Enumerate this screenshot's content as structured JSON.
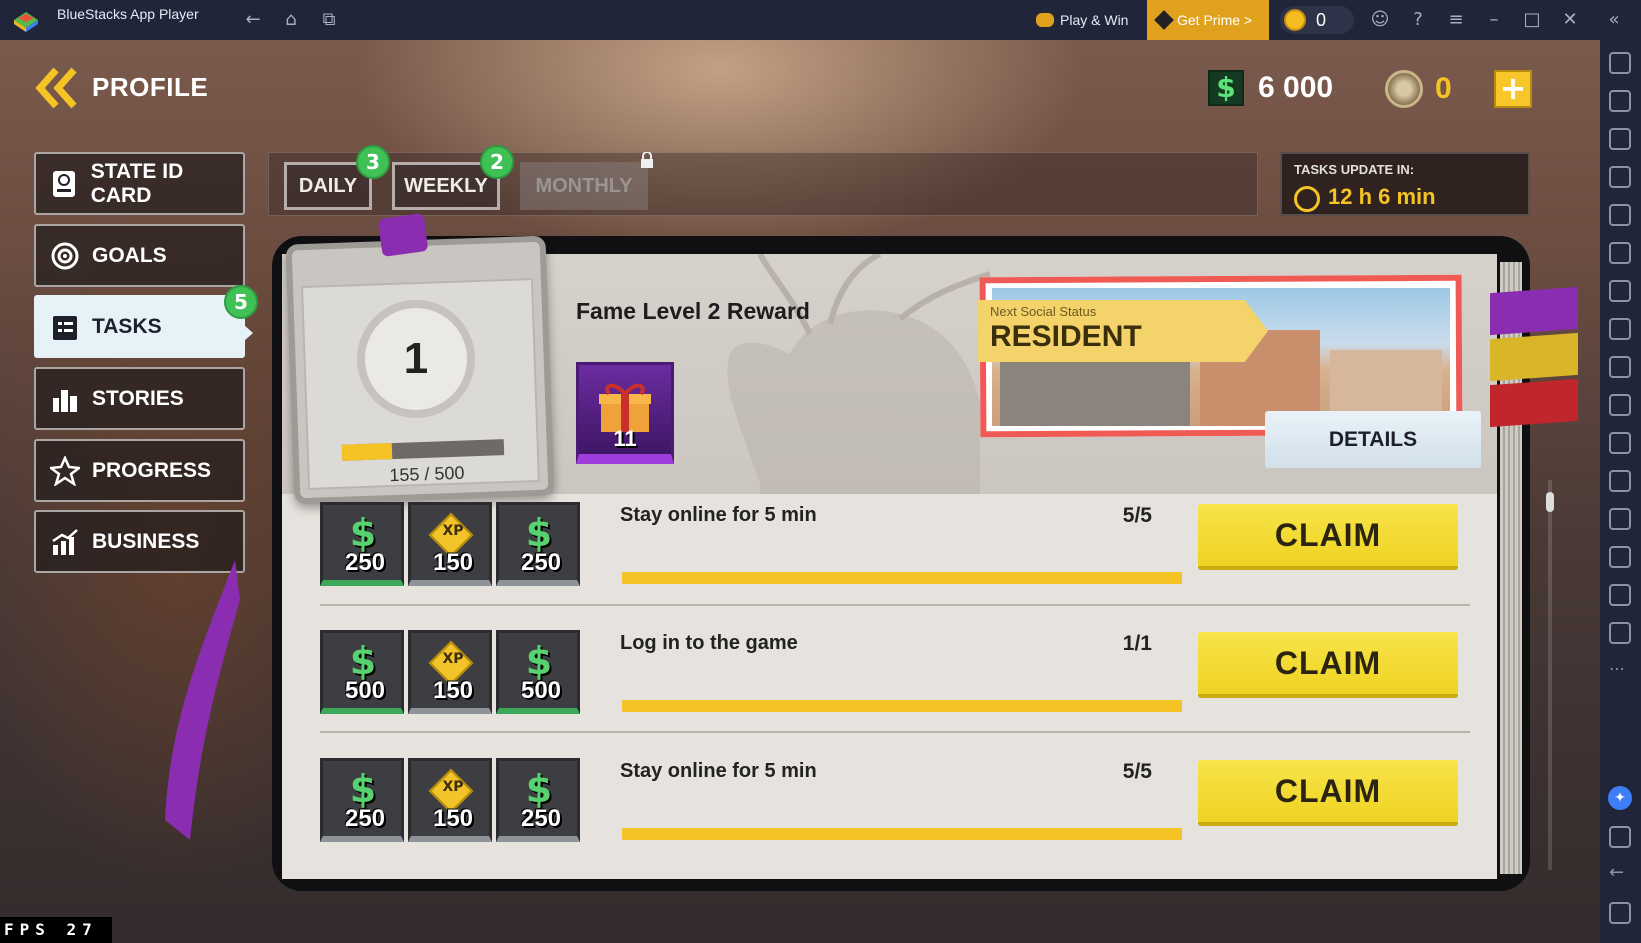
{
  "window": {
    "title": "BlueStacks App Player",
    "play_win": "Play & Win",
    "get_prime": "Get Prime >",
    "coins": "0"
  },
  "header": {
    "title": "PROFILE",
    "money": "6 000",
    "gold": "0"
  },
  "menu": {
    "items": [
      {
        "label": "STATE ID CARD",
        "icon": "id-card-icon"
      },
      {
        "label": "GOALS",
        "icon": "target-icon"
      },
      {
        "label": "TASKS",
        "icon": "checklist-icon",
        "active": true,
        "badge": "5"
      },
      {
        "label": "STORIES",
        "icon": "city-icon"
      },
      {
        "label": "PROGRESS",
        "icon": "star-icon"
      },
      {
        "label": "BUSINESS",
        "icon": "chart-icon"
      }
    ]
  },
  "tabs": [
    {
      "label": "DAILY",
      "badge": "3"
    },
    {
      "label": "WEEKLY",
      "badge": "2"
    },
    {
      "label": "MONTHLY",
      "locked": true
    }
  ],
  "timer": {
    "label": "TASKS UPDATE IN:",
    "value": "12 h 6 min"
  },
  "fame": {
    "level": "1",
    "progress_text": "155 / 500",
    "progress_fraction": 0.31,
    "reward_title": "Fame Level 2 Reward",
    "reward_count": "11"
  },
  "status": {
    "small": "Next Social Status",
    "big": "RESIDENT",
    "details_label": "DETAILS"
  },
  "tasks": [
    {
      "title": "Stay online for 5 min",
      "progress": "5/5",
      "fraction": 1.0,
      "claim": "CLAIM",
      "rewards": [
        {
          "type": "money",
          "value": "250"
        },
        {
          "type": "xp",
          "label": "XP",
          "value": "150"
        },
        {
          "type": "money",
          "value": "250"
        }
      ]
    },
    {
      "title": "Log in to the game",
      "progress": "1/1",
      "fraction": 1.0,
      "claim": "CLAIM",
      "rewards": [
        {
          "type": "money",
          "value": "500"
        },
        {
          "type": "xp",
          "label": "XP",
          "value": "150"
        },
        {
          "type": "money",
          "value": "500"
        }
      ]
    },
    {
      "title": "Stay online for 5 min",
      "progress": "5/5",
      "fraction": 1.0,
      "claim": "CLAIM",
      "rewards": [
        {
          "type": "money",
          "value": "250"
        },
        {
          "type": "xp",
          "label": "XP",
          "value": "150"
        },
        {
          "type": "money",
          "value": "250"
        }
      ]
    }
  ],
  "fps": {
    "label": "FPS",
    "value": "27"
  },
  "colors": {
    "accent_yellow": "#f5c424",
    "badge_green": "#3fc155",
    "bluestacks_bar": "#202539"
  }
}
